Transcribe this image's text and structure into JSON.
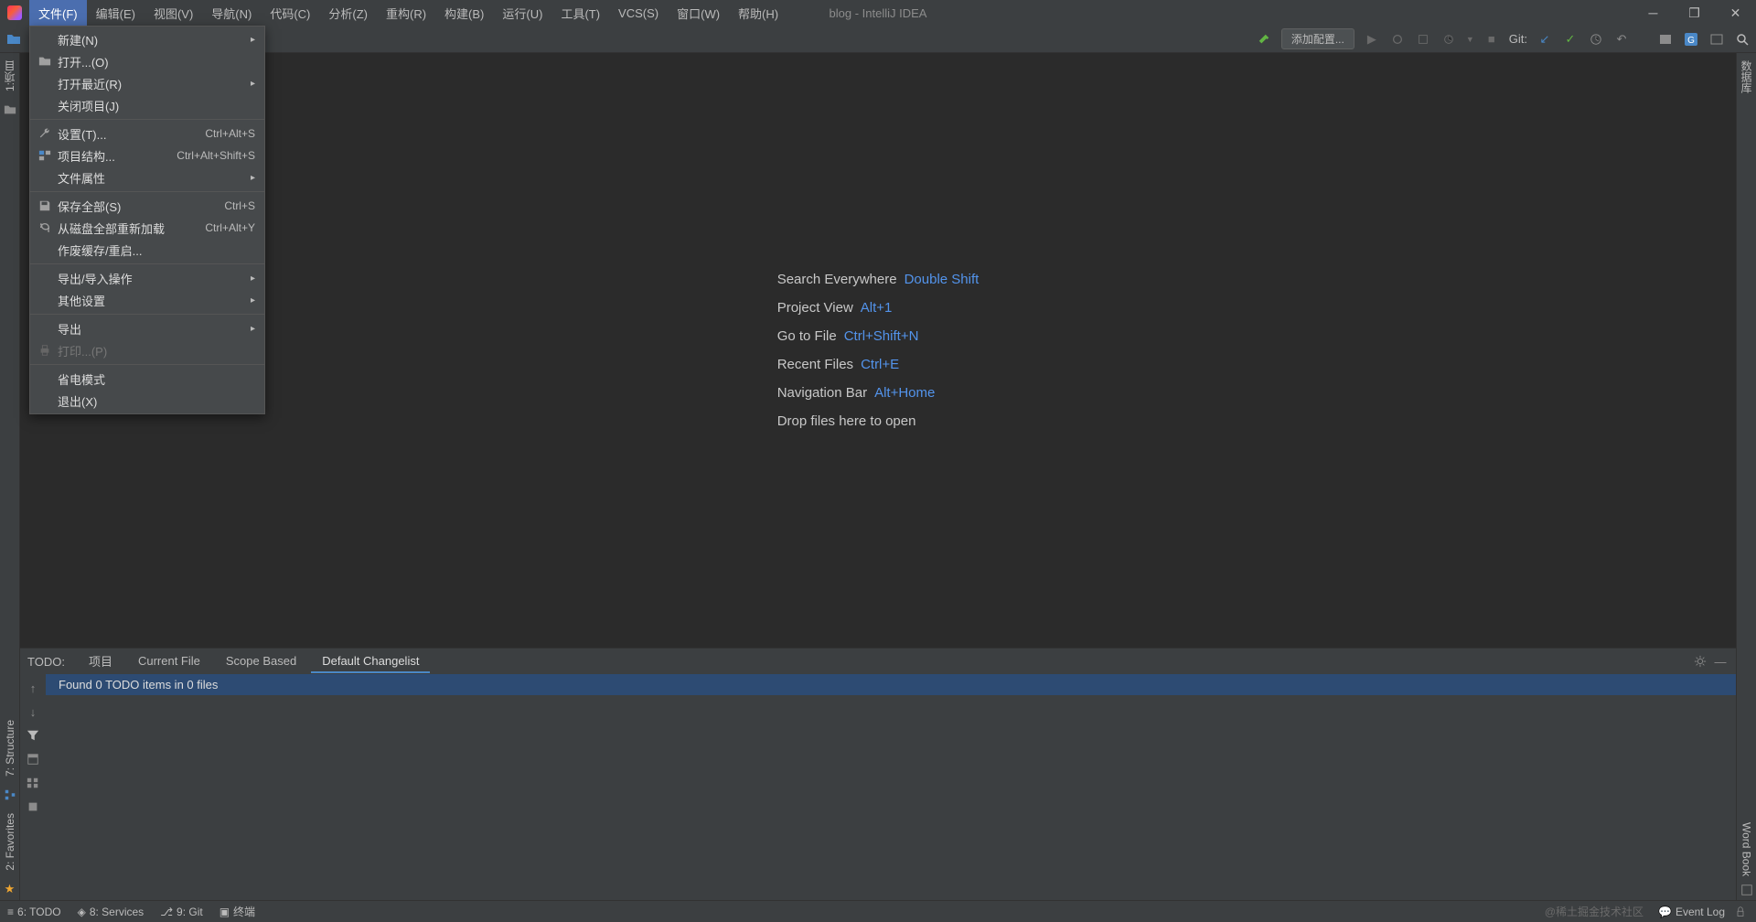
{
  "window": {
    "title": "blog - IntelliJ IDEA"
  },
  "menubar": {
    "items": [
      {
        "label": "文件(F)",
        "active": true
      },
      {
        "label": "编辑(E)"
      },
      {
        "label": "视图(V)"
      },
      {
        "label": "导航(N)"
      },
      {
        "label": "代码(C)"
      },
      {
        "label": "分析(Z)"
      },
      {
        "label": "重构(R)"
      },
      {
        "label": "构建(B)"
      },
      {
        "label": "运行(U)"
      },
      {
        "label": "工具(T)"
      },
      {
        "label": "VCS(S)"
      },
      {
        "label": "窗口(W)"
      },
      {
        "label": "帮助(H)"
      }
    ]
  },
  "file_menu": {
    "items": [
      {
        "label": "新建(N)",
        "submenu": true
      },
      {
        "label": "打开...(O)",
        "icon": "folder"
      },
      {
        "label": "打开最近(R)",
        "submenu": true
      },
      {
        "label": "关闭项目(J)"
      },
      {
        "sep": true
      },
      {
        "label": "设置(T)...",
        "icon": "wrench",
        "shortcut": "Ctrl+Alt+S"
      },
      {
        "label": "项目结构...",
        "icon": "structure",
        "shortcut": "Ctrl+Alt+Shift+S"
      },
      {
        "label": "文件属性",
        "submenu": true
      },
      {
        "sep": true
      },
      {
        "label": "保存全部(S)",
        "icon": "save",
        "shortcut": "Ctrl+S"
      },
      {
        "label": "从磁盘全部重新加载",
        "icon": "reload",
        "shortcut": "Ctrl+Alt+Y"
      },
      {
        "label": "作废缓存/重启..."
      },
      {
        "sep": true
      },
      {
        "label": "导出/导入操作",
        "submenu": true
      },
      {
        "label": "其他设置",
        "submenu": true
      },
      {
        "sep": true
      },
      {
        "label": "导出",
        "submenu": true
      },
      {
        "label": "打印...(P)",
        "icon": "print",
        "disabled": true
      },
      {
        "sep": true
      },
      {
        "label": "省电模式"
      },
      {
        "label": "退出(X)"
      }
    ]
  },
  "toolbar": {
    "run_config": "添加配置...",
    "git_label": "Git:"
  },
  "left_tabs": {
    "project": "1:项目",
    "structure": "7: Structure",
    "favorites": "2: Favorites"
  },
  "right_tabs": {
    "db": "数据库",
    "wordbook": "Word Book"
  },
  "editor_hints": {
    "rows": [
      {
        "label": "Search Everywhere",
        "key": "Double Shift"
      },
      {
        "label": "Project View",
        "key": "Alt+1"
      },
      {
        "label": "Go to File",
        "key": "Ctrl+Shift+N"
      },
      {
        "label": "Recent Files",
        "key": "Ctrl+E"
      },
      {
        "label": "Navigation Bar",
        "key": "Alt+Home"
      },
      {
        "label": "Drop files here to open",
        "key": ""
      }
    ]
  },
  "todo": {
    "title": "TODO:",
    "tabs": [
      {
        "label": "项目"
      },
      {
        "label": "Current File"
      },
      {
        "label": "Scope Based"
      },
      {
        "label": "Default Changelist",
        "active": true
      }
    ],
    "found": "Found 0 TODO items in 0 files"
  },
  "statusbar": {
    "items": [
      {
        "label": "6: TODO",
        "underline": "6"
      },
      {
        "label": "8: Services",
        "underline": "8"
      },
      {
        "label": "9: Git",
        "underline": "9"
      },
      {
        "label": "终端"
      }
    ],
    "watermark": "@稀土掘金技术社区",
    "eventlog": "Event Log"
  }
}
